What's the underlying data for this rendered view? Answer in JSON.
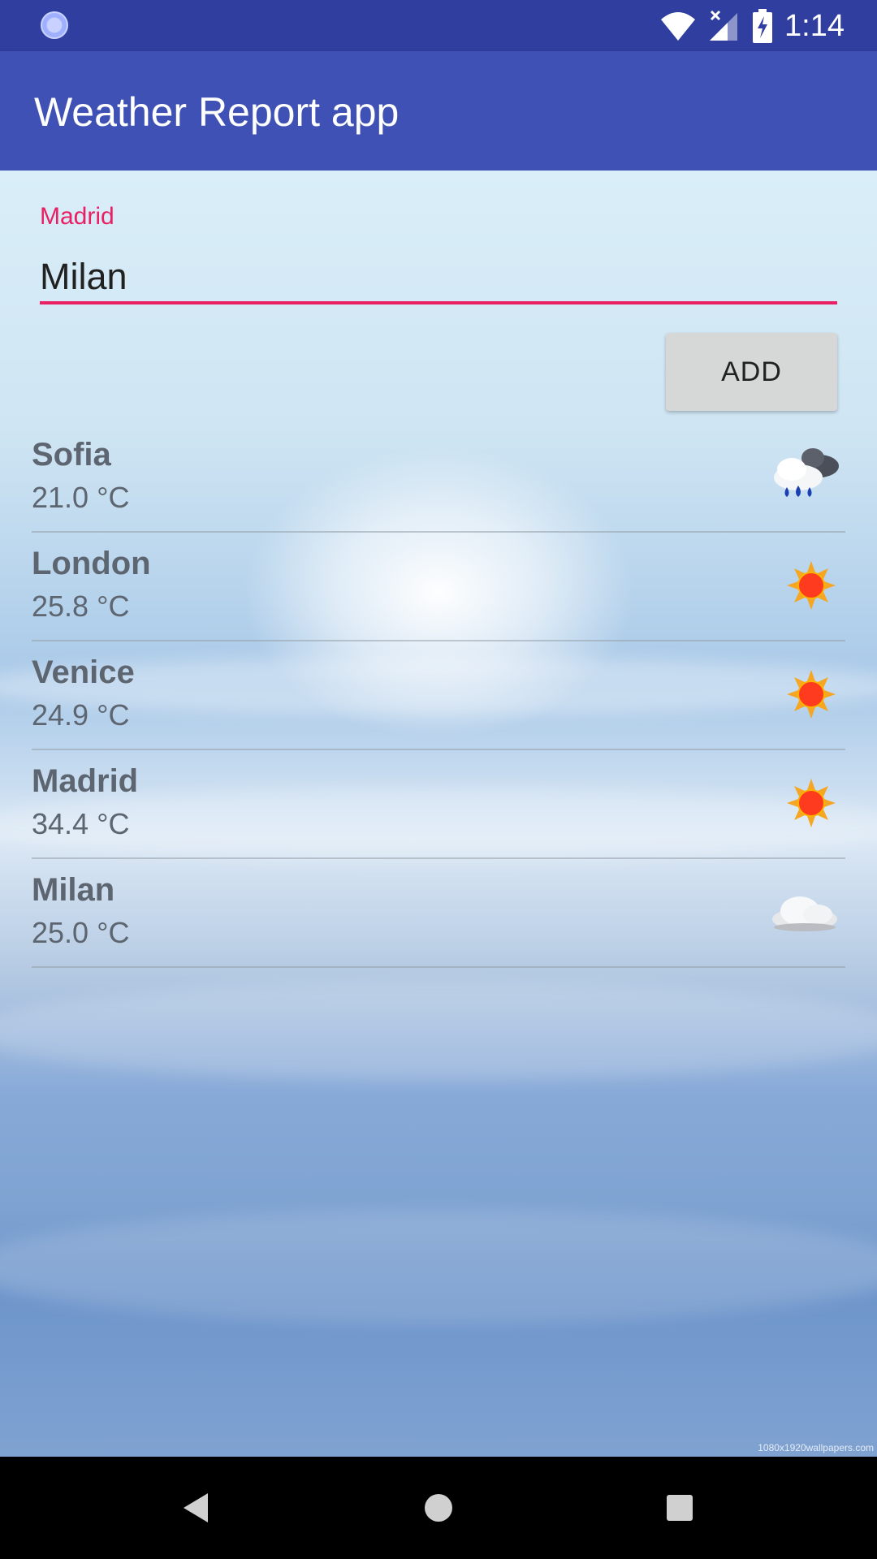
{
  "status_bar": {
    "time": "1:14"
  },
  "app_bar": {
    "title": "Weather Report app"
  },
  "input": {
    "label": "Madrid",
    "value": "Milan"
  },
  "add_button": {
    "label": "ADD"
  },
  "cities": [
    {
      "name": "Sofia",
      "temp": "21.0 °C",
      "icon": "rain-cloud-icon"
    },
    {
      "name": "London",
      "temp": "25.8 °C",
      "icon": "sun-icon"
    },
    {
      "name": "Venice",
      "temp": "24.9 °C",
      "icon": "sun-icon"
    },
    {
      "name": "Madrid",
      "temp": "34.4 °C",
      "icon": "sun-icon"
    },
    {
      "name": "Milan",
      "temp": "25.0 °C",
      "icon": "cloud-icon"
    }
  ],
  "watermark": "1080x1920wallpapers.com",
  "colors": {
    "status_bar": "#303f9f",
    "app_bar": "#3f51b5",
    "accent": "#e91e63",
    "button": "#d6d7d7"
  }
}
